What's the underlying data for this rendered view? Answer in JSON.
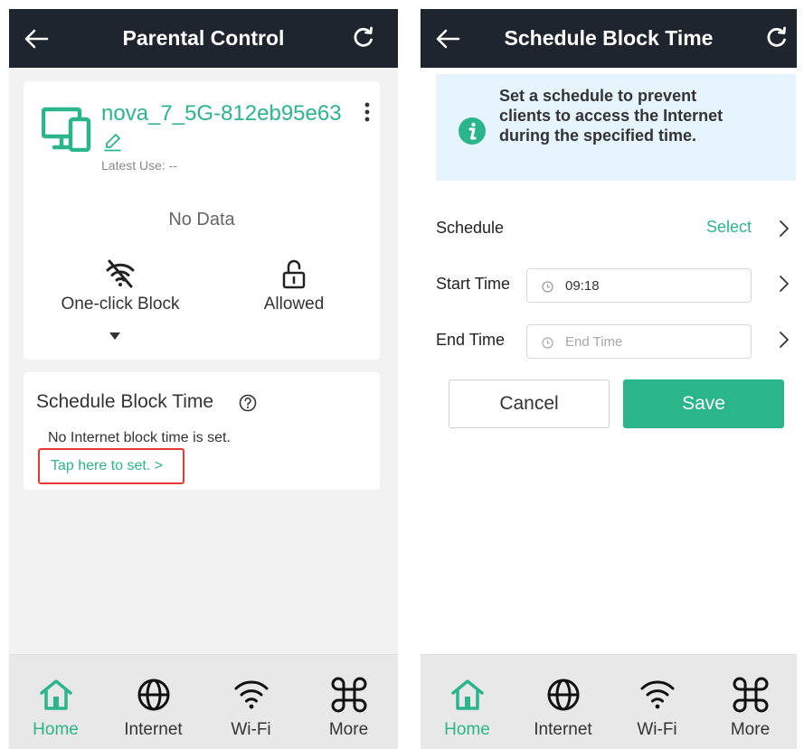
{
  "left_screen": {
    "header": {
      "title": "Parental Control"
    },
    "device": {
      "name": "nova_7_5G-812eb95e63",
      "latest_use_label": "Latest Use:",
      "latest_use_value": "--",
      "usage": "No Data",
      "actions": [
        {
          "label": "One-click Block",
          "icon": "wifi-off-icon"
        },
        {
          "label": "Allowed",
          "icon": "unlock-icon"
        }
      ]
    },
    "schedule": {
      "title": "Schedule Block Time",
      "status": "No Internet block time is set.",
      "link": "Tap here to set. >"
    }
  },
  "right_screen": {
    "header": {
      "title": "Schedule Block Time"
    },
    "info": "Set a schedule to prevent clients to access the Internet during the specified time.",
    "form": {
      "schedule_label": "Schedule",
      "schedule_value": "Select",
      "start_label": "Start Time",
      "start_value": "09:18",
      "end_label": "End Time",
      "end_placeholder": "End Time"
    },
    "buttons": {
      "cancel": "Cancel",
      "save": "Save"
    }
  },
  "bottom_nav": {
    "items": [
      {
        "label": "Home",
        "icon": "home-icon",
        "active": true
      },
      {
        "label": "Internet",
        "icon": "globe-icon",
        "active": false
      },
      {
        "label": "Wi-Fi",
        "icon": "wifi-icon",
        "active": false
      },
      {
        "label": "More",
        "icon": "command-icon",
        "active": false
      }
    ]
  },
  "colors": {
    "accent": "#2bb58a",
    "header_bg": "#1e252e",
    "info_bg": "#e6f4fd",
    "highlight": "#e53935"
  }
}
